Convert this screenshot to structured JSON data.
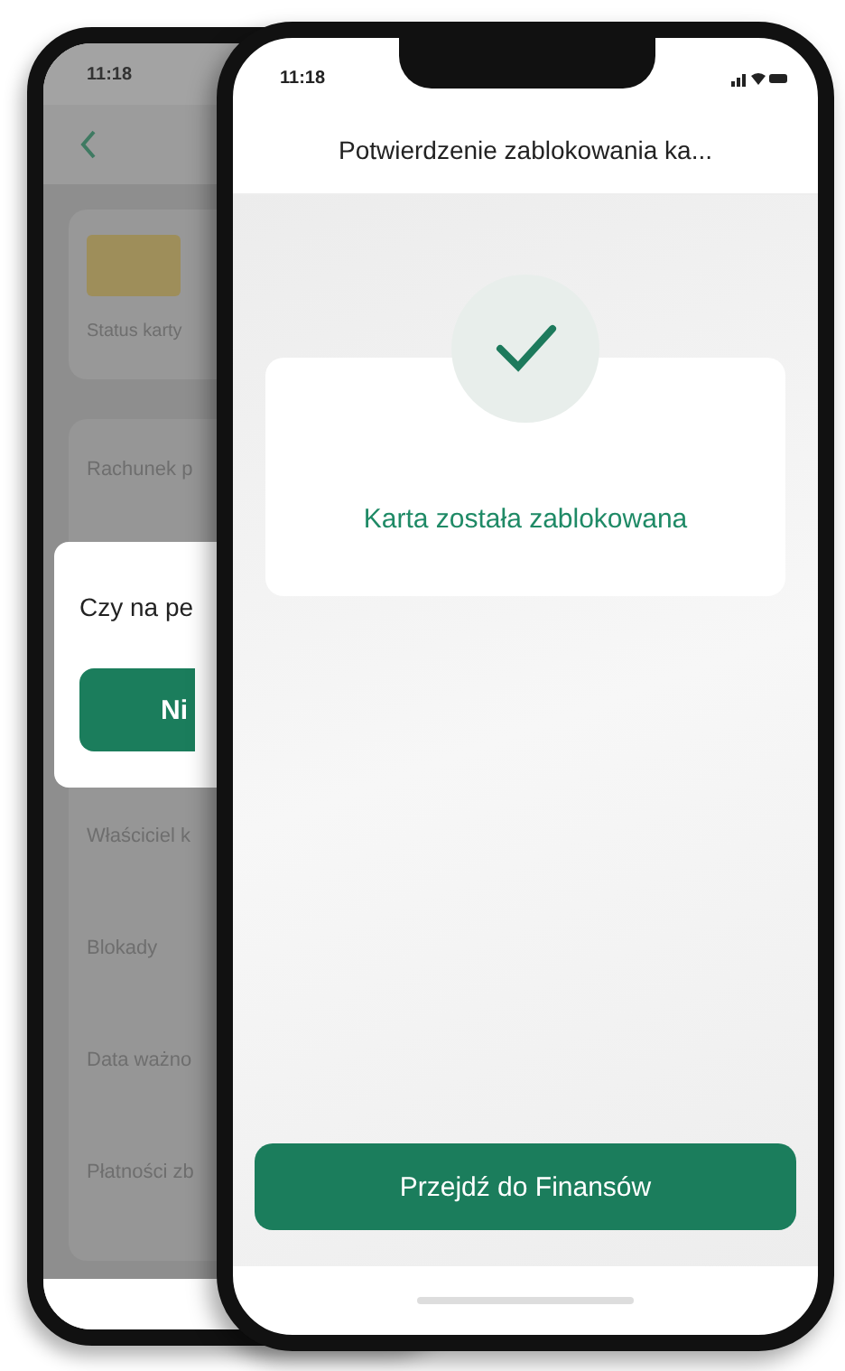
{
  "back_phone": {
    "status_time": "11:18",
    "card_status_label": "Status karty",
    "rows_above": [
      "Rachunek p"
    ],
    "dialog": {
      "text": "Czy na pe",
      "button": "Ni"
    },
    "rows_below": [
      "Właściciel k",
      "Blokady",
      "Data ważno",
      "Płatności zb"
    ]
  },
  "front_phone": {
    "status_time": "11:18",
    "title": "Potwierdzenie zablokowania ka...",
    "message": "Karta została zablokowana",
    "button": "Przejdź do Finansów"
  }
}
